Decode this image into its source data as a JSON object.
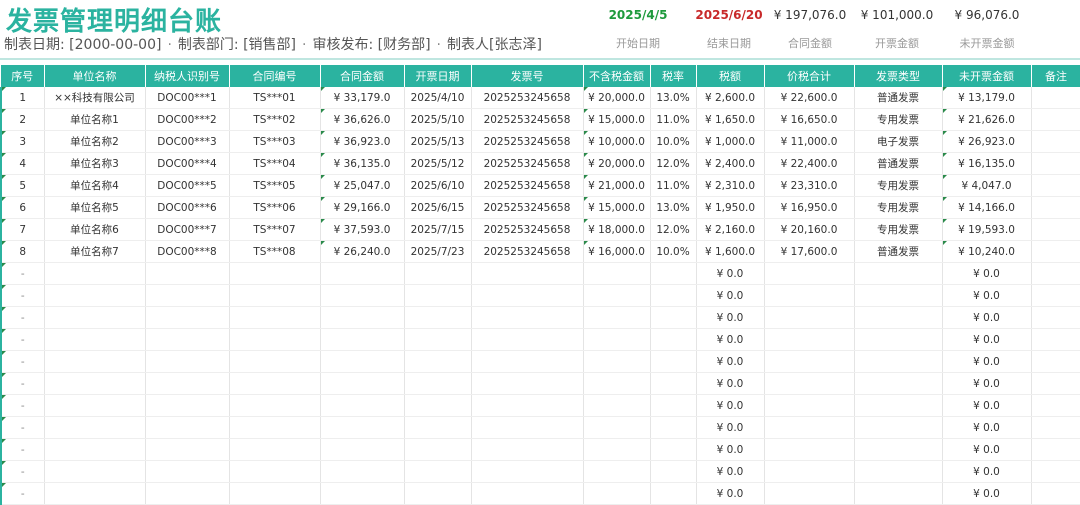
{
  "header": {
    "title": "发票管理明细台账",
    "meta": {
      "date_label": "制表日期: [2000-00-00]",
      "dept_label": "制表部门: [销售部]",
      "review_label": "审核发布: [财务部]",
      "maker_label": "制表人[张志泽]",
      "separator": "·"
    },
    "stats": [
      {
        "value": "2025/4/5",
        "label": "开始日期",
        "style": "green"
      },
      {
        "value": "2025/6/20",
        "label": "结束日期",
        "style": "red"
      },
      {
        "value": "¥ 197,076.0",
        "label": "合同金额",
        "style": "plain"
      },
      {
        "value": "¥ 101,000.0",
        "label": "开票金额",
        "style": "plain"
      },
      {
        "value": "¥ 96,076.0",
        "label": "未开票金额",
        "style": "plain"
      }
    ]
  },
  "table": {
    "columns": [
      "序号",
      "单位名称",
      "纳税人识别号",
      "合同编号",
      "合同金额",
      "开票日期",
      "发票号",
      "不含税金额",
      "税率",
      "税额",
      "价税合计",
      "发票类型",
      "未开票金额",
      "备注"
    ],
    "rows": [
      [
        "1",
        "××科技有限公司",
        "DOC00***1",
        "TS***01",
        "¥ 33,179.0",
        "2025/4/10",
        "2025253245658",
        "¥ 20,000.0",
        "13.0%",
        "¥ 2,600.0",
        "¥ 22,600.0",
        "普通发票",
        "¥ 13,179.0",
        ""
      ],
      [
        "2",
        "单位名称1",
        "DOC00***2",
        "TS***02",
        "¥ 36,626.0",
        "2025/5/10",
        "2025253245658",
        "¥ 15,000.0",
        "11.0%",
        "¥ 1,650.0",
        "¥ 16,650.0",
        "专用发票",
        "¥ 21,626.0",
        ""
      ],
      [
        "3",
        "单位名称2",
        "DOC00***3",
        "TS***03",
        "¥ 36,923.0",
        "2025/5/13",
        "2025253245658",
        "¥ 10,000.0",
        "10.0%",
        "¥ 1,000.0",
        "¥ 11,000.0",
        "电子发票",
        "¥ 26,923.0",
        ""
      ],
      [
        "4",
        "单位名称3",
        "DOC00***4",
        "TS***04",
        "¥ 36,135.0",
        "2025/5/12",
        "2025253245658",
        "¥ 20,000.0",
        "12.0%",
        "¥ 2,400.0",
        "¥ 22,400.0",
        "普通发票",
        "¥ 16,135.0",
        ""
      ],
      [
        "5",
        "单位名称4",
        "DOC00***5",
        "TS***05",
        "¥ 25,047.0",
        "2025/6/10",
        "2025253245658",
        "¥ 21,000.0",
        "11.0%",
        "¥ 2,310.0",
        "¥ 23,310.0",
        "专用发票",
        "¥ 4,047.0",
        ""
      ],
      [
        "6",
        "单位名称5",
        "DOC00***6",
        "TS***06",
        "¥ 29,166.0",
        "2025/6/15",
        "2025253245658",
        "¥ 15,000.0",
        "13.0%",
        "¥ 1,950.0",
        "¥ 16,950.0",
        "专用发票",
        "¥ 14,166.0",
        ""
      ],
      [
        "7",
        "单位名称6",
        "DOC00***7",
        "TS***07",
        "¥ 37,593.0",
        "2025/7/15",
        "2025253245658",
        "¥ 18,000.0",
        "12.0%",
        "¥ 2,160.0",
        "¥ 20,160.0",
        "专用发票",
        "¥ 19,593.0",
        ""
      ],
      [
        "8",
        "单位名称7",
        "DOC00***8",
        "TS***08",
        "¥ 26,240.0",
        "2025/7/23",
        "2025253245658",
        "¥ 16,000.0",
        "10.0%",
        "¥ 1,600.0",
        "¥ 17,600.0",
        "普通发票",
        "¥ 10,240.0",
        ""
      ],
      [
        "-",
        "",
        "",
        "",
        "",
        "",
        "",
        "",
        "",
        "¥ 0.0",
        "",
        "",
        "¥ 0.0",
        ""
      ],
      [
        "-",
        "",
        "",
        "",
        "",
        "",
        "",
        "",
        "",
        "¥ 0.0",
        "",
        "",
        "¥ 0.0",
        ""
      ],
      [
        "-",
        "",
        "",
        "",
        "",
        "",
        "",
        "",
        "",
        "¥ 0.0",
        "",
        "",
        "¥ 0.0",
        ""
      ],
      [
        "-",
        "",
        "",
        "",
        "",
        "",
        "",
        "",
        "",
        "¥ 0.0",
        "",
        "",
        "¥ 0.0",
        ""
      ],
      [
        "-",
        "",
        "",
        "",
        "",
        "",
        "",
        "",
        "",
        "¥ 0.0",
        "",
        "",
        "¥ 0.0",
        ""
      ],
      [
        "-",
        "",
        "",
        "",
        "",
        "",
        "",
        "",
        "",
        "¥ 0.0",
        "",
        "",
        "¥ 0.0",
        ""
      ],
      [
        "-",
        "",
        "",
        "",
        "",
        "",
        "",
        "",
        "",
        "¥ 0.0",
        "",
        "",
        "¥ 0.0",
        ""
      ],
      [
        "-",
        "",
        "",
        "",
        "",
        "",
        "",
        "",
        "",
        "¥ 0.0",
        "",
        "",
        "¥ 0.0",
        ""
      ],
      [
        "-",
        "",
        "",
        "",
        "",
        "",
        "",
        "",
        "",
        "¥ 0.0",
        "",
        "",
        "¥ 0.0",
        ""
      ],
      [
        "-",
        "",
        "",
        "",
        "",
        "",
        "",
        "",
        "",
        "¥ 0.0",
        "",
        "",
        "¥ 0.0",
        ""
      ],
      [
        "-",
        "",
        "",
        "",
        "",
        "",
        "",
        "",
        "",
        "¥ 0.0",
        "",
        "",
        "¥ 0.0",
        ""
      ]
    ]
  },
  "colors": {
    "accent": "#2bb3a0",
    "header_text": "#ffffff",
    "start_date": "#1e9a3c",
    "end_date": "#c8292a"
  }
}
